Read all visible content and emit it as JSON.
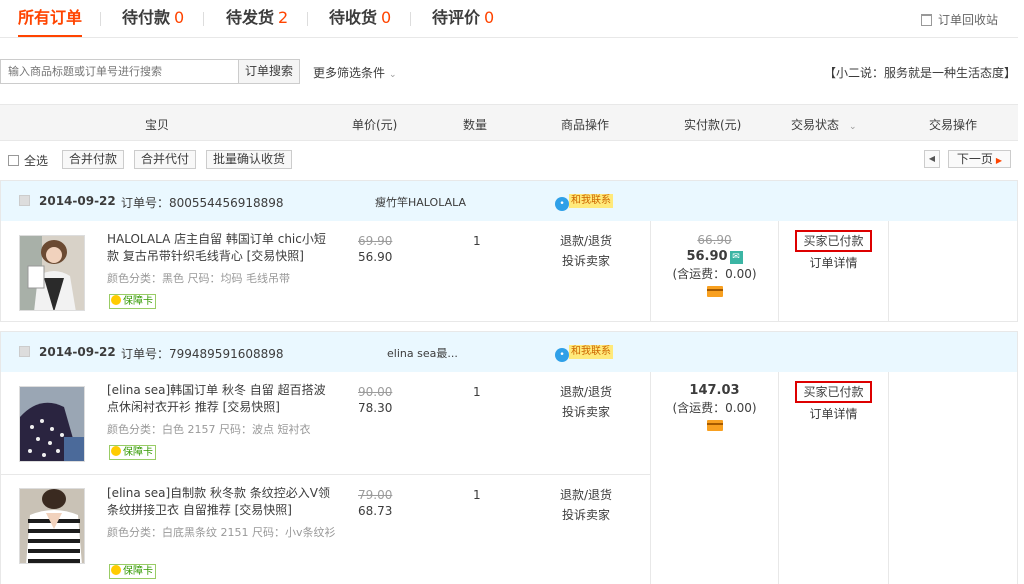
{
  "tabs": [
    {
      "label": "所有订单",
      "count": ""
    },
    {
      "label": "待付款",
      "count": "0"
    },
    {
      "label": "待发货",
      "count": "2"
    },
    {
      "label": "待收货",
      "count": "0"
    },
    {
      "label": "待评价",
      "count": "0"
    }
  ],
  "recycle_label": "订单回收站",
  "search": {
    "placeholder": "输入商品标题或订单号进行搜索",
    "button": "订单搜索"
  },
  "more_filters": "更多筛选条件",
  "slogan": "【小二说：服务就是一种生活态度】",
  "columns": [
    "宝贝",
    "单价(元)",
    "数量",
    "商品操作",
    "实付款(元)",
    "交易状态",
    "交易操作"
  ],
  "batch": {
    "select_all": "全选",
    "merge_pay": "合并付款",
    "merge_proxy": "合并代付",
    "batch_confirm": "批量确认收货",
    "next_page": "下一页"
  },
  "orders": [
    {
      "date": "2014-09-22",
      "order_no": "订单号：800554456918898",
      "shop": "瘦竹竿HALOLALA",
      "contact": "和我联系",
      "items": [
        {
          "title": "HALOLALA 店主自留 韩国订单 chic小短款 复古吊带针织毛线背心 [交易快照]",
          "spec": "颜色分类：黑色 尺码：均码 毛线吊带",
          "badge": "保障卡",
          "orig_price": "69.90",
          "price": "56.90",
          "qty": "1",
          "op1": "退款/退货",
          "op2": "投诉卖家"
        }
      ],
      "pay": {
        "orig": "66.90",
        "paid": "56.90",
        "mobile": "✉",
        "shipping": "(含运费：0.00)"
      },
      "status": "买家已付款",
      "detail": "订单详情"
    },
    {
      "date": "2014-09-22",
      "order_no": "订单号：799489591608898",
      "shop": "elina sea最...",
      "contact": "和我联系",
      "items": [
        {
          "title": "[elina sea]韩国订单 秋冬 自留 超百搭波点休闲衬衣开衫 推荐 [交易快照]",
          "spec": "颜色分类：白色 2157 尺码：波点 短衬衣",
          "badge": "保障卡",
          "orig_price": "90.00",
          "price": "78.30",
          "qty": "1",
          "op1": "退款/退货",
          "op2": "投诉卖家"
        },
        {
          "title": "[elina sea]自制款 秋冬款 条纹控必入V领条纹拼接卫衣 自留推荐 [交易快照]",
          "spec": "颜色分类：白底黑条纹 2151 尺码：小v条纹衫",
          "badge": "保障卡",
          "orig_price": "79.00",
          "price": "68.73",
          "qty": "1",
          "op1": "退款/退货",
          "op2": "投诉卖家"
        }
      ],
      "pay": {
        "paid": "147.03",
        "shipping": "(含运费：0.00)"
      },
      "status": "买家已付款",
      "detail": "订单详情"
    }
  ],
  "colors": {
    "accent": "#ff4400",
    "order_header_bg": "#eaf8ff",
    "status_border": "#dd0000"
  }
}
